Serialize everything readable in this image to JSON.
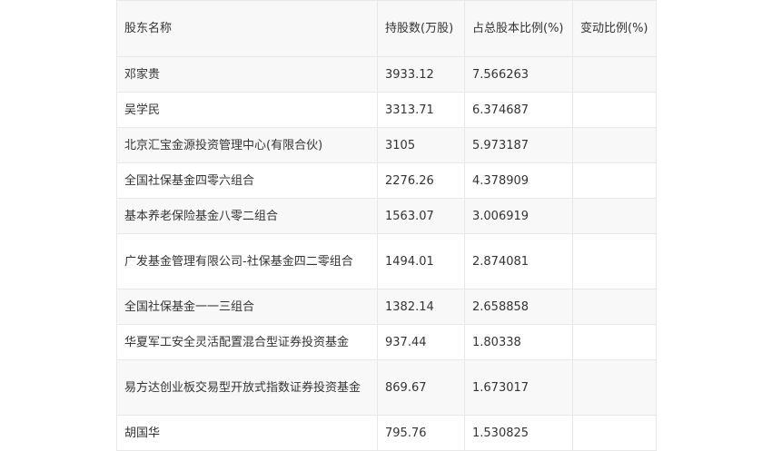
{
  "table": {
    "headers": [
      "股东名称",
      "持股数(万股)",
      "占总股本比例(%)",
      "变动比例(%)"
    ],
    "rows": [
      {
        "name": "邓家贵",
        "shares": "3933.12",
        "ratio": "7.566263",
        "change": ""
      },
      {
        "name": "吴学民",
        "shares": "3313.71",
        "ratio": "6.374687",
        "change": ""
      },
      {
        "name": "北京汇宝金源投资管理中心(有限合伙)",
        "shares": "3105",
        "ratio": "5.973187",
        "change": ""
      },
      {
        "name": "全国社保基金四零六组合",
        "shares": "2276.26",
        "ratio": "4.378909",
        "change": ""
      },
      {
        "name": "基本养老保险基金八零二组合",
        "shares": "1563.07",
        "ratio": "3.006919",
        "change": ""
      },
      {
        "name": "广发基金管理有限公司-社保基金四二零组合",
        "shares": "1494.01",
        "ratio": "2.874081",
        "change": ""
      },
      {
        "name": "全国社保基金一一三组合",
        "shares": "1382.14",
        "ratio": "2.658858",
        "change": ""
      },
      {
        "name": "华夏军工安全灵活配置混合型证券投资基金",
        "shares": "937.44",
        "ratio": "1.80338",
        "change": ""
      },
      {
        "name": "易方达创业板交易型开放式指数证券投资基金",
        "shares": "869.67",
        "ratio": "1.673017",
        "change": ""
      },
      {
        "name": "胡国华",
        "shares": "795.76",
        "ratio": "1.530825",
        "change": ""
      }
    ]
  }
}
